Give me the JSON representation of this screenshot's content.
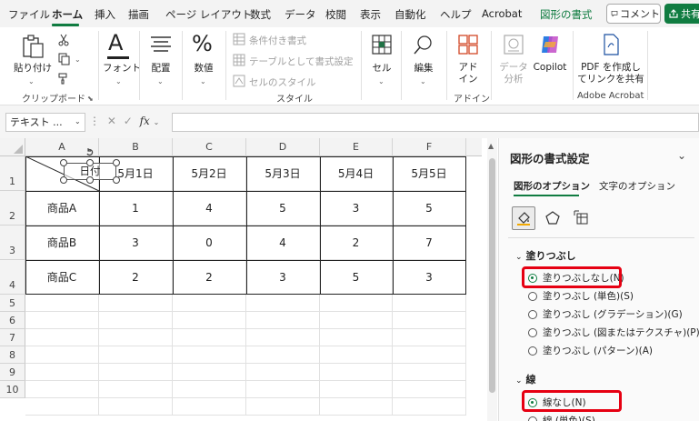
{
  "menu": {
    "tabs": [
      "ファイル",
      "ホーム",
      "挿入",
      "描画",
      "ページ レイアウト",
      "数式",
      "データ",
      "校閲",
      "表示",
      "自動化",
      "ヘルプ",
      "Acrobat",
      "図形の書式"
    ],
    "active_tab": "ホーム",
    "comment_label": "コメント",
    "share_label": "共有"
  },
  "ribbon": {
    "clipboard": {
      "paste": "貼り付け",
      "group": "クリップボード"
    },
    "font": {
      "label": "フォント"
    },
    "alignment": {
      "label": "配置"
    },
    "number": {
      "label": "数値"
    },
    "style": {
      "conditional": "条件付き書式",
      "table": "テーブルとして書式設定",
      "cell_style": "セルのスタイル",
      "group": "スタイル"
    },
    "cells": {
      "label": "セル"
    },
    "editing": {
      "label": "編集"
    },
    "addin": {
      "label_line1": "アド",
      "label_line2": "イン",
      "group": "アドイン"
    },
    "data_analysis": {
      "line1": "データ",
      "line2": "分析"
    },
    "copilot": {
      "label": "Copilot"
    },
    "acrobat": {
      "line1": "PDF を作成し",
      "line2": "てリンクを共有",
      "group": "Adobe Acrobat"
    }
  },
  "formula_bar": {
    "name_box": "テキスト ...",
    "fx": "fx",
    "value": ""
  },
  "sheet": {
    "columns": [
      "A",
      "B",
      "C",
      "D",
      "E",
      "F"
    ],
    "row_numbers": [
      "1",
      "2",
      "3",
      "4",
      "5",
      "6",
      "7",
      "8",
      "9",
      "10"
    ],
    "header_row": [
      "",
      "5月1日",
      "5月2日",
      "5月3日",
      "5月4日",
      "5月5日"
    ],
    "rows": [
      [
        "商品A",
        "1",
        "4",
        "5",
        "3",
        "5"
      ],
      [
        "商品B",
        "3",
        "0",
        "4",
        "2",
        "7"
      ],
      [
        "商品C",
        "2",
        "2",
        "3",
        "5",
        "3"
      ]
    ],
    "shape_text": "日付"
  },
  "pane": {
    "title": "図形の書式設定",
    "tabs": [
      "図形のオプション",
      "文字のオプション"
    ],
    "fill_section": "塗りつぶし",
    "fill_options": [
      "塗りつぶしなし(N)",
      "塗りつぶし (単色)(S)",
      "塗りつぶし (グラデーション)(G)",
      "塗りつぶし (図またはテクスチャ)(P)",
      "塗りつぶし (パターン)(A)"
    ],
    "line_section": "線",
    "line_options": [
      "線なし(N)",
      "線 (単色)(S)"
    ],
    "highlight_color": "#e60012",
    "accent_color": "#107c41"
  }
}
